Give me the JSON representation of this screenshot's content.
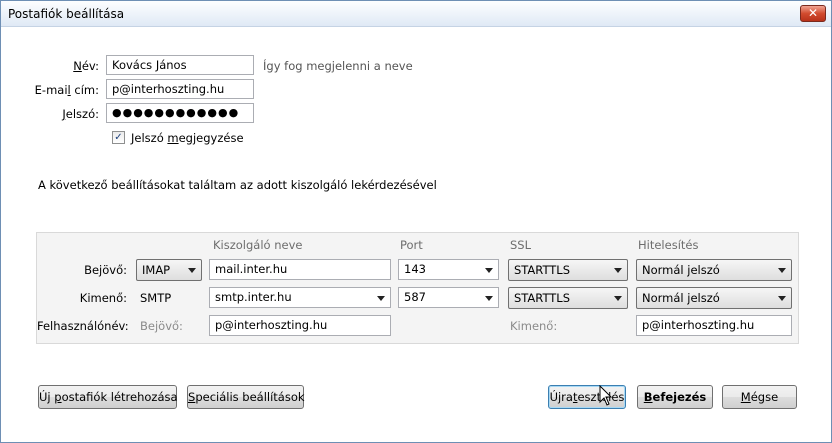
{
  "window": {
    "title": "Postafiók beállítása",
    "close_glyph": "✕"
  },
  "form": {
    "name_label_u": "N",
    "name_label_rest": "év:",
    "name_value": "Kovács János",
    "name_hint": "Így fog megjelenni a neve",
    "email_label_a": "E-mai",
    "email_label_u": "l",
    "email_label_b": " cím:",
    "email_value": "p@interhoszting.hu",
    "password_label_u": "J",
    "password_label_rest": "elszó:",
    "password_value": "●●●●●●●●●●●●",
    "remember_checked": "✓",
    "remember_label_a": "Jelszó ",
    "remember_label_u": "m",
    "remember_label_b": "egjegyzése"
  },
  "message": "A következő beállításokat találtam az adott kiszolgáló lekérdezésével",
  "server_table": {
    "headers": {
      "server": "Kiszolgáló neve",
      "port": "Port",
      "ssl": "SSL",
      "auth": "Hitelesítés"
    },
    "incoming": {
      "label": "Bejövő:",
      "protocol": "IMAP",
      "server": "mail.inter.hu",
      "port": "143",
      "ssl": "STARTTLS",
      "auth": "Normál jelszó"
    },
    "outgoing": {
      "label": "Kimenő:",
      "protocol": "SMTP",
      "server": "smtp.inter.hu",
      "port": "587",
      "ssl": "STARTTLS",
      "auth": "Normál jelszó"
    },
    "username": {
      "label": "Felhasználónév:",
      "incoming_label": "Bejövő:",
      "incoming_value": "p@interhoszting.hu",
      "outgoing_label": "Kimenő:",
      "outgoing_value": "p@interhoszting.hu"
    }
  },
  "buttons": {
    "new_account_a": "Új ",
    "new_account_u": "p",
    "new_account_b": "ostafiók létrehozása",
    "advanced_a": "",
    "advanced_u": "S",
    "advanced_b": "peciális beállítások",
    "retest_a": "Újra",
    "retest_u": "t",
    "retest_b": "esztelés",
    "done_a": "",
    "done_u": "B",
    "done_b": "efejezés",
    "cancel_a": "",
    "cancel_u": "M",
    "cancel_b": "égse"
  }
}
